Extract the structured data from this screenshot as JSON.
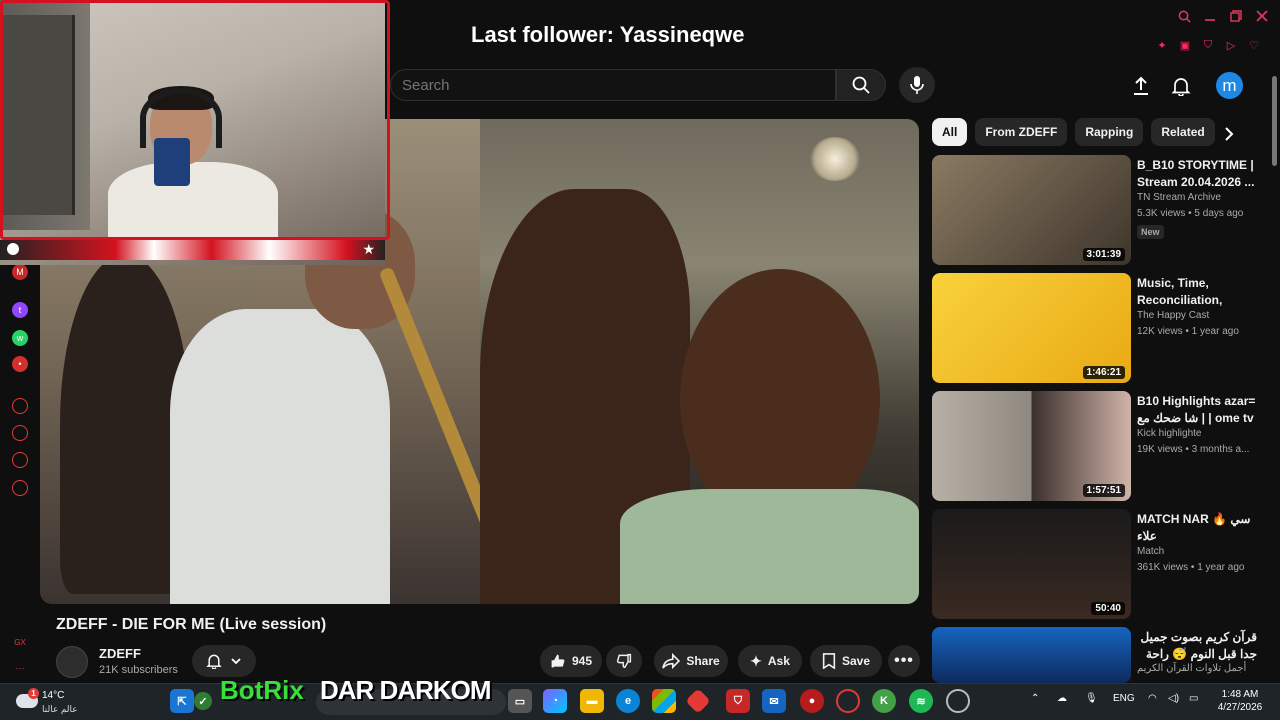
{
  "overlay": {
    "last_follower": "Last follower: Yassineqwe",
    "botrix": "BotRix",
    "dar_darkom": "DAR DARKOM"
  },
  "header": {
    "search_placeholder": "Search",
    "avatar_letter": "m"
  },
  "video": {
    "title": "ZDEFF - DIE FOR ME (Live session)",
    "channel": "ZDEFF",
    "subscribers": "21K subscribers",
    "likes": "945",
    "share_label": "Share",
    "ask_label": "Ask",
    "save_label": "Save"
  },
  "chips": [
    "All",
    "From ZDEFF",
    "Rapping",
    "Related"
  ],
  "recommendations": [
    {
      "title": "B_B10 STORYTIME | Stream 20.04.2026 ...",
      "channel": "TN Stream Archive",
      "meta": "5.3K views • 5 days ago",
      "duration": "3:01:39",
      "badge": "New",
      "thumb_color": "#6b5b4a"
    },
    {
      "title": "Music, Time, Reconciliation, Gal3...",
      "channel": "The Happy Cast",
      "meta": "12K views • 1 year ago",
      "duration": "1:46:21",
      "badge": "",
      "thumb_color": "#f4c21a"
    },
    {
      "title": "B10 Highlights azar= شا ضحك مع | | ome tv",
      "channel": "Kick highlighte",
      "meta": "19K views • 3 months a...",
      "duration": "1:57:51",
      "badge": "",
      "thumb_color": "#9a8f88"
    },
    {
      "title": "MATCH NAR 🔥 سي علاء",
      "channel": "Match",
      "meta": "361K views • 1 year ago",
      "duration": "50:40",
      "badge": "",
      "thumb_color": "#1d1d1d"
    },
    {
      "title": "قرآن كريم بصوت جميل جدا قبل النوم 😴 راحة نفسية لا",
      "channel": "أجمل تلاوات القرآن الكريم",
      "meta": "",
      "duration": "",
      "badge": "",
      "thumb_color": "#0d47a1"
    }
  ],
  "taskbar": {
    "temperature": "14°C",
    "location": "عالم عالنا",
    "weather_alert": "1",
    "search_text": "Search",
    "language": "ENG",
    "time": "1:48 AM",
    "date": "4/27/2026"
  },
  "colors": {
    "accent_red": "#d4121f",
    "youtube_bg": "#0f0f0f",
    "botrix_green": "#39e03c",
    "avatar_blue": "#1e88e5"
  }
}
